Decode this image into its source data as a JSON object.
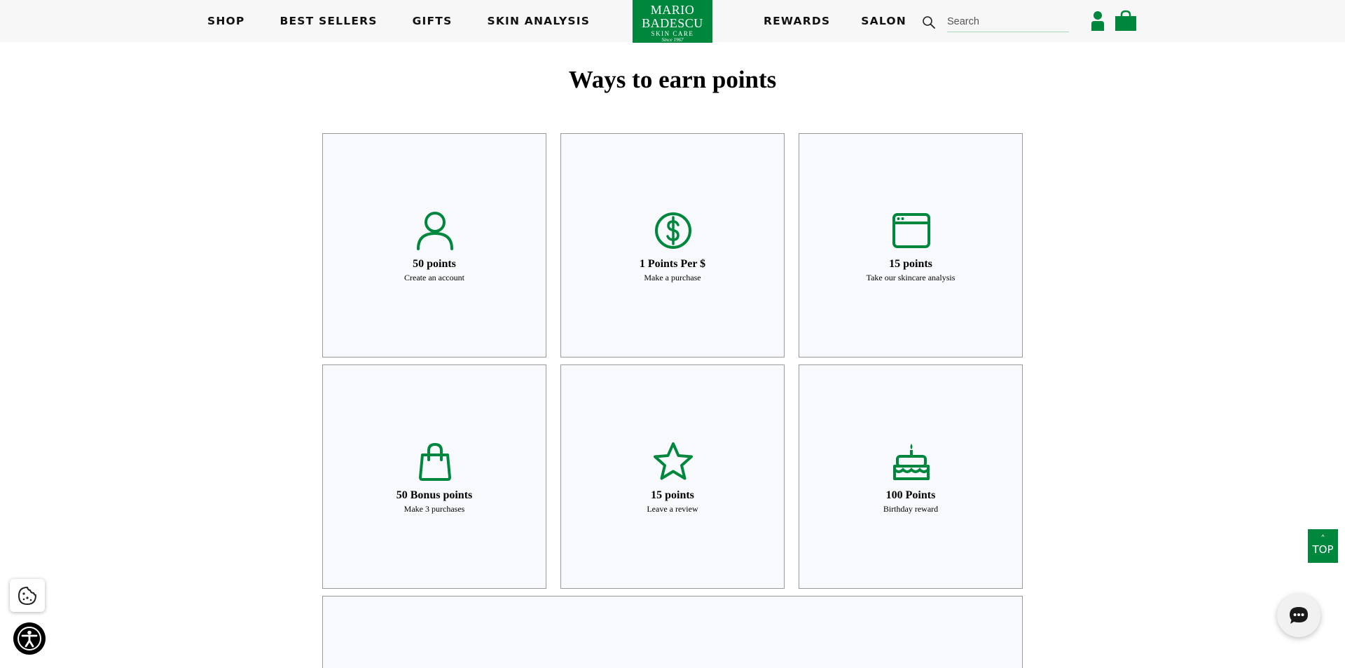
{
  "header": {
    "nav_left": [
      {
        "label": "SHOP"
      },
      {
        "label": "BEST SELLERS"
      },
      {
        "label": "GIFTS"
      },
      {
        "label": "SKIN ANALYSIS"
      }
    ],
    "nav_right": [
      {
        "label": "REWARDS"
      },
      {
        "label": "SALON"
      }
    ],
    "logo": {
      "line1": "MARIO",
      "line2": "BADESCU",
      "line3": "SKIN CARE",
      "line4": "Since 1967"
    },
    "search": {
      "placeholder": "Search",
      "icon": "search-icon"
    },
    "icons": {
      "account": "user-icon",
      "cart": "shopping-bag-icon"
    }
  },
  "main": {
    "title": "Ways to earn points",
    "cards": [
      {
        "points": "50 points",
        "description": "Create an account",
        "icon": "user-icon"
      },
      {
        "points": "1 Points Per $",
        "description": "Make a purchase",
        "icon": "dollar-icon"
      },
      {
        "points": "15 points",
        "description": "Take our skincare analysis",
        "icon": "browser-window-icon"
      },
      {
        "points": "50 Bonus points",
        "description": "Make 3 purchases",
        "icon": "shopping-bag-icon"
      },
      {
        "points": "15 points",
        "description": "Leave a review",
        "icon": "star-icon"
      },
      {
        "points": "100 Points",
        "description": "Birthday reward",
        "icon": "birthday-cake-icon"
      }
    ]
  },
  "floating": {
    "top_button": {
      "arrow": "^",
      "label": "TOP"
    },
    "chat": "chat-icon",
    "cookie": "cookie-icon",
    "accessibility": "accessibility-icon"
  },
  "colors": {
    "brand_green": "#00873e",
    "card_bg": "#f8f9fd",
    "header_bg": "#f7f7f7"
  }
}
